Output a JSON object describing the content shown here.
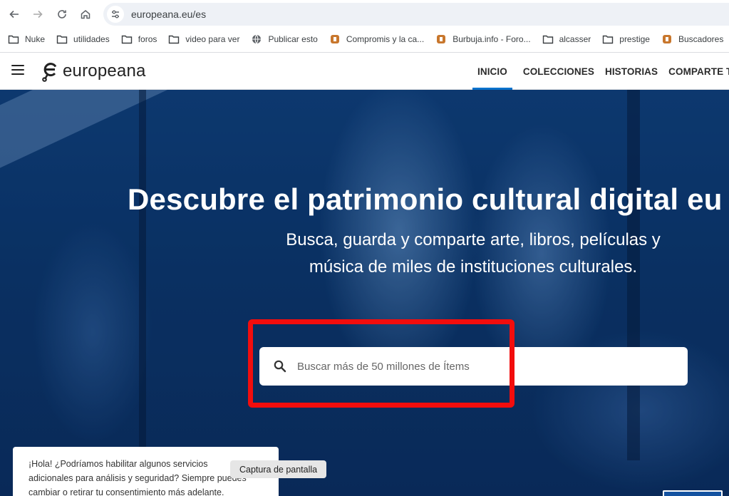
{
  "browser": {
    "url": "europeana.eu/es",
    "bookmarks": [
      {
        "label": "Nuke",
        "icon": "folder-icon"
      },
      {
        "label": "utilidades",
        "icon": "folder-icon"
      },
      {
        "label": "foros",
        "icon": "folder-icon"
      },
      {
        "label": "video para ver",
        "icon": "folder-icon"
      },
      {
        "label": "Publicar esto",
        "icon": "globe-icon"
      },
      {
        "label": "Compromis y la ca...",
        "icon": "favicon-icon"
      },
      {
        "label": "Burbuja.info - Foro...",
        "icon": "favicon-icon"
      },
      {
        "label": "alcasser",
        "icon": "folder-icon"
      },
      {
        "label": "prestige",
        "icon": "folder-icon"
      },
      {
        "label": "Buscadores",
        "icon": "favicon-icon"
      }
    ]
  },
  "header": {
    "logo_text": "europeana",
    "nav": [
      {
        "label": "INICIO",
        "active": true
      },
      {
        "label": "COLECCIONES",
        "active": false
      },
      {
        "label": "HISTORIAS",
        "active": false
      },
      {
        "label": "COMPARTE TUS D",
        "active": false
      }
    ]
  },
  "hero": {
    "title": "Descubre el patrimonio cultural digital eu",
    "subtitle_line1": "Busca, guarda y comparte arte, libros, películas y",
    "subtitle_line2": "música de miles de instituciones culturales.",
    "search_placeholder": "Buscar más de 50 millones de Ítems"
  },
  "consent": {
    "line1": "¡Hola! ¿Podríamos habilitar algunos servicios",
    "line2": "adicionales para análisis y seguridad? Siempre puedes",
    "line3": "cambiar o retirar tu consentimiento más adelante."
  },
  "tooltip": {
    "label": "Captura de pantalla"
  },
  "colors": {
    "accent": "#0a72cc",
    "hero_blue": "#0b3568",
    "highlight_red": "#f20d0d"
  }
}
